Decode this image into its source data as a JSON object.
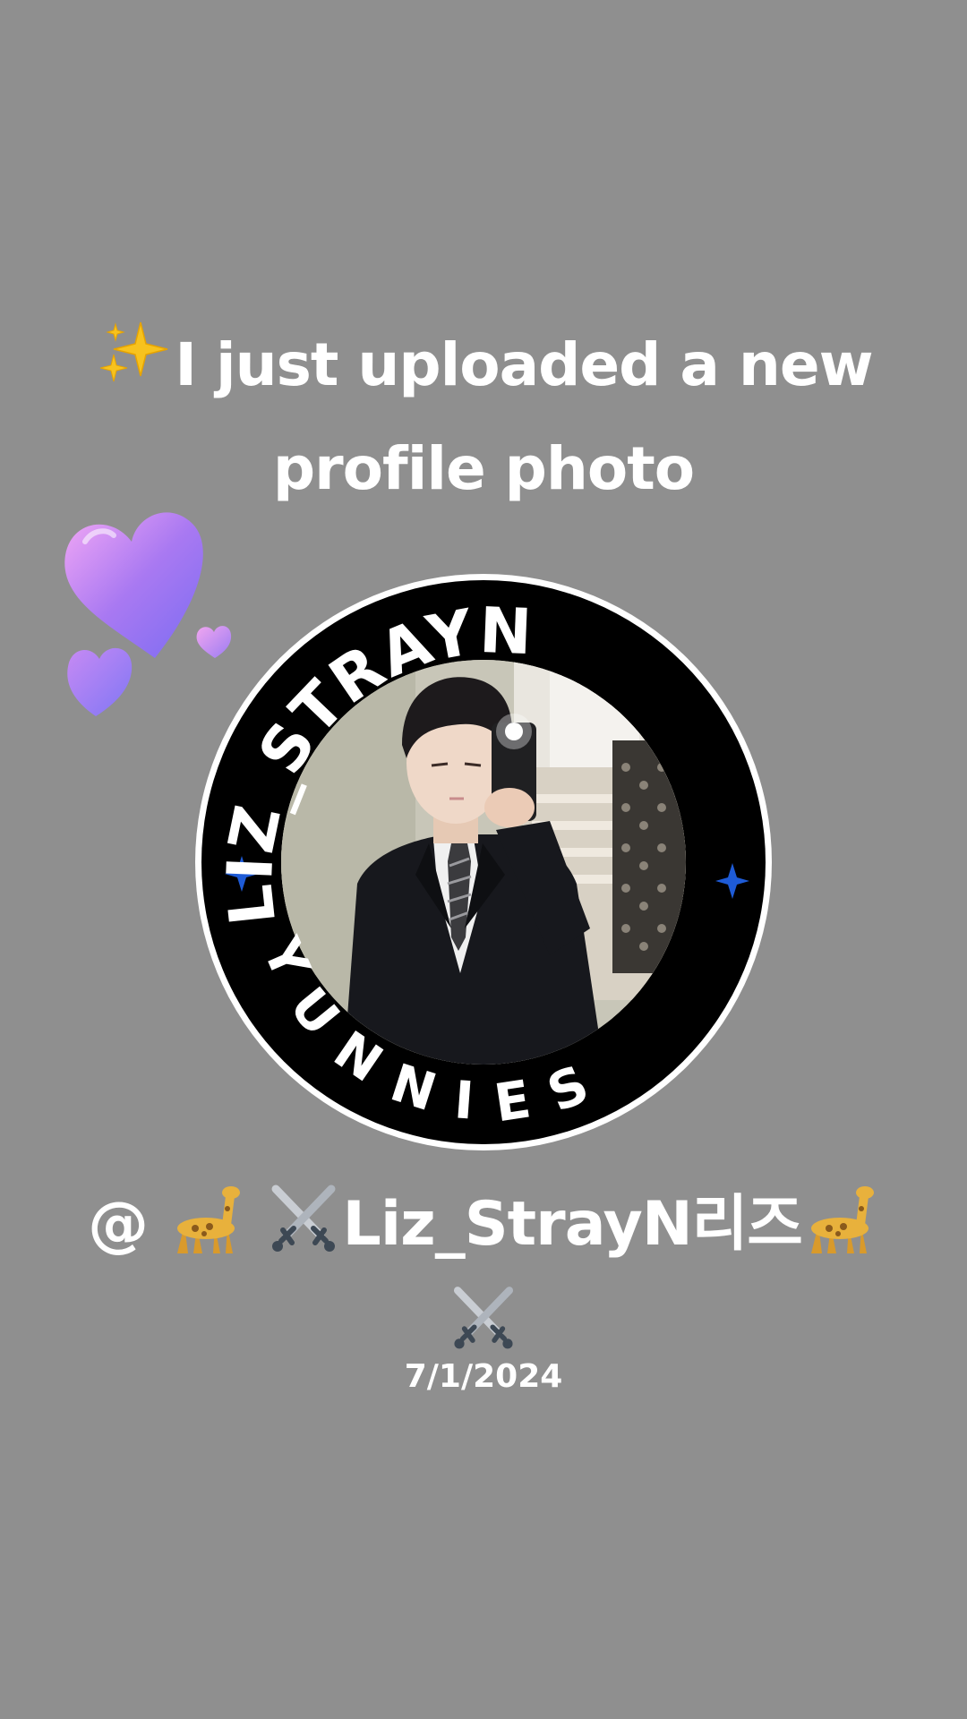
{
  "headline": {
    "line1": "I just uploaded a new",
    "line2": "profile photo",
    "leading_icon": "sparkles-icon"
  },
  "badge": {
    "top_arc_text": "LIZ_STRAYN",
    "bottom_arc_text": "YUNNIES",
    "ring_color": "#000000",
    "text_color": "#ffffff",
    "star_color": "#1e5bd6"
  },
  "decoration": {
    "hearts_icon": "purple-hearts-icon"
  },
  "profile": {
    "at_symbol": "@",
    "name": "Liz_StrayN리즈",
    "leading_icons": [
      "giraffe-icon",
      "crossed-swords-icon"
    ],
    "trailing_icons": [
      "giraffe-icon",
      "crossed-swords-icon"
    ]
  },
  "date": "7/1/2024",
  "colors": {
    "background": "#8f8f8f",
    "text": "#ffffff"
  }
}
